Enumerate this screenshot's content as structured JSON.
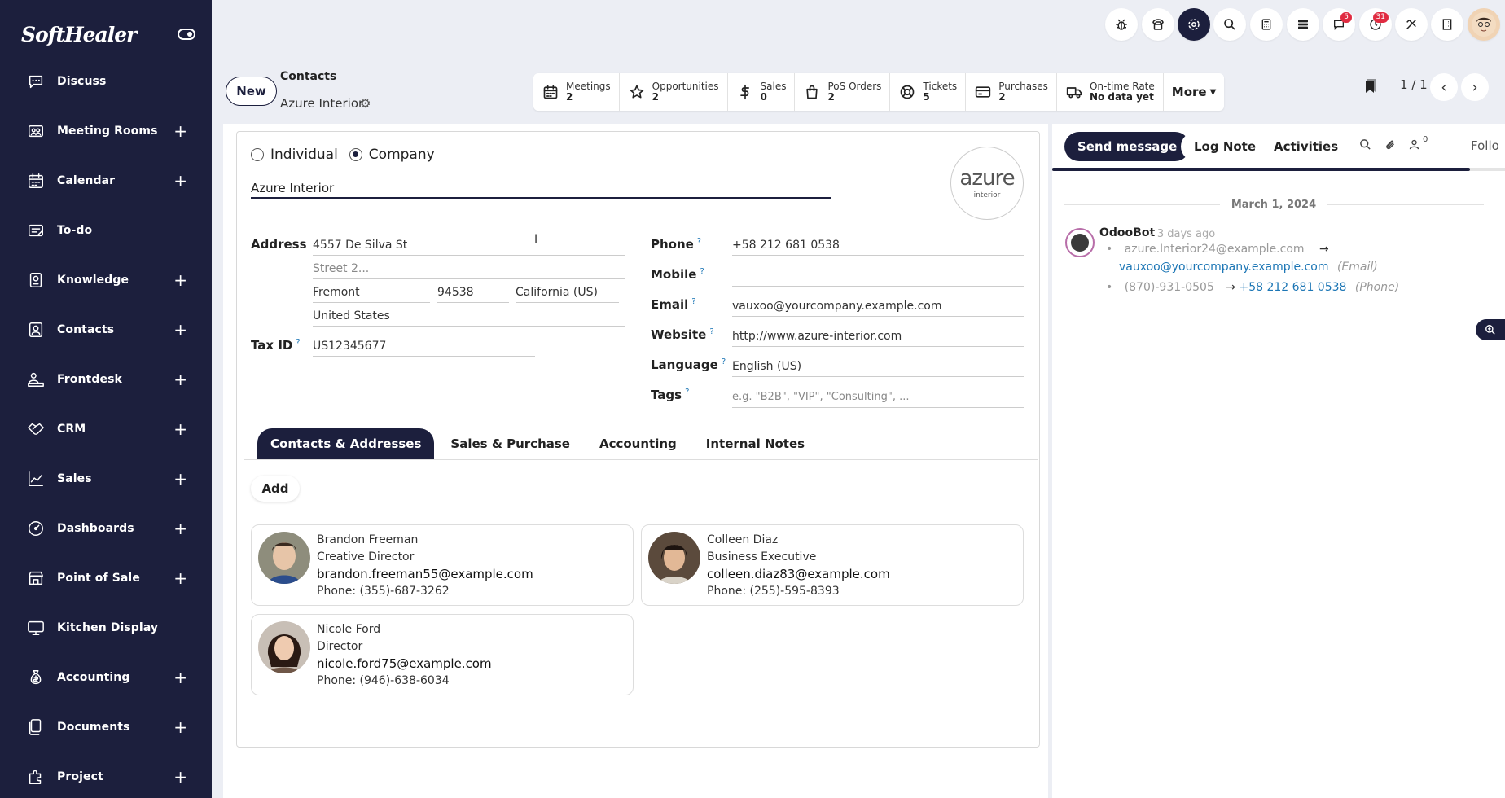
{
  "sidebar": {
    "brand": "SoftHealer",
    "items": [
      {
        "label": "Discuss",
        "icon": "chat-icon",
        "plus": false
      },
      {
        "label": "Meeting Rooms",
        "icon": "meeting-room-icon",
        "plus": true
      },
      {
        "label": "Calendar",
        "icon": "calendar-icon",
        "plus": true
      },
      {
        "label": "To-do",
        "icon": "todo-icon",
        "plus": false
      },
      {
        "label": "Knowledge",
        "icon": "knowledge-icon",
        "plus": true
      },
      {
        "label": "Contacts",
        "icon": "contacts-icon",
        "plus": true
      },
      {
        "label": "Frontdesk",
        "icon": "frontdesk-icon",
        "plus": true
      },
      {
        "label": "CRM",
        "icon": "handshake-icon",
        "plus": true
      },
      {
        "label": "Sales",
        "icon": "chart-up-icon",
        "plus": true
      },
      {
        "label": "Dashboards",
        "icon": "dashboard-icon",
        "plus": true
      },
      {
        "label": "Point of Sale",
        "icon": "store-icon",
        "plus": true
      },
      {
        "label": "Kitchen Display",
        "icon": "monitor-icon",
        "plus": false
      },
      {
        "label": "Accounting",
        "icon": "money-bag-icon",
        "plus": true
      },
      {
        "label": "Documents",
        "icon": "documents-icon",
        "plus": true
      },
      {
        "label": "Project",
        "icon": "puzzle-icon",
        "plus": true
      }
    ],
    "plus_symbol": "+"
  },
  "topbar": {
    "badges": {
      "messages": "5",
      "activities": "31"
    }
  },
  "control": {
    "new_label": "New",
    "breadcrumb_parent": "Contacts",
    "breadcrumb_current": "Azure Interior",
    "smart_buttons": [
      {
        "label": "Meetings",
        "value": "2",
        "icon": "calendar-icon"
      },
      {
        "label": "Opportunities",
        "value": "2",
        "icon": "star-icon"
      },
      {
        "label": "Sales",
        "value": "0",
        "icon": "dollar-icon"
      },
      {
        "label": "PoS Orders",
        "value": "2",
        "icon": "shopping-bag-icon"
      },
      {
        "label": "Tickets",
        "value": "5",
        "icon": "lifebuoy-icon"
      },
      {
        "label": "Purchases",
        "value": "2",
        "icon": "credit-card-icon"
      },
      {
        "label": "On-time Rate",
        "value": "No data yet",
        "icon": "truck-icon"
      }
    ],
    "more_label": "More",
    "pager": "1 / 1"
  },
  "form": {
    "type_individual": "Individual",
    "type_company": "Company",
    "name": "Azure Interior",
    "logo_text": "azure",
    "logo_sub": "interior",
    "address_label": "Address",
    "street": "4557 De Silva St",
    "street2_placeholder": "Street 2...",
    "city": "Fremont",
    "zip": "94538",
    "state": "California (US)",
    "country": "United States",
    "taxid_label": "Tax ID",
    "taxid": "US12345677",
    "phone_label": "Phone",
    "phone": "+58 212 681 0538",
    "mobile_label": "Mobile",
    "mobile": "",
    "email_label": "Email",
    "email": "vauxoo@yourcompany.example.com",
    "website_label": "Website",
    "website": "http://www.azure-interior.com",
    "language_label": "Language",
    "language": "English (US)",
    "tags_label": "Tags",
    "tags_placeholder": "e.g. \"B2B\", \"VIP\", \"Consulting\", ...",
    "help_mark": "?"
  },
  "tabs": [
    "Contacts & Addresses",
    "Sales & Purchase",
    "Accounting",
    "Internal Notes"
  ],
  "add_label": "Add",
  "contacts": [
    {
      "name": "Brandon Freeman",
      "title": "Creative Director",
      "email": "brandon.freeman55@example.com",
      "phone": "Phone: (355)-687-3262"
    },
    {
      "name": "Colleen Diaz",
      "title": "Business Executive",
      "email": "colleen.diaz83@example.com",
      "phone": "Phone: (255)-595-8393"
    },
    {
      "name": "Nicole Ford",
      "title": "Director",
      "email": "nicole.ford75@example.com",
      "phone": "Phone: (946)-638-6034"
    }
  ],
  "chatter": {
    "send_message": "Send message",
    "log_note": "Log Note",
    "activities": "Activities",
    "followers_count": "0",
    "follow_label": "Follo",
    "date": "March 1, 2024",
    "author": "OdooBot",
    "time": "- 3 days ago",
    "old_email": "azure.Interior24@example.com",
    "new_email": "vauxoo@yourcompany.example.com",
    "email_kind": "(Email)",
    "old_phone": "(870)-931-0505",
    "new_phone": "+58 212 681 0538",
    "phone_kind": "(Phone)",
    "arrow": "→",
    "bullet": "•"
  }
}
